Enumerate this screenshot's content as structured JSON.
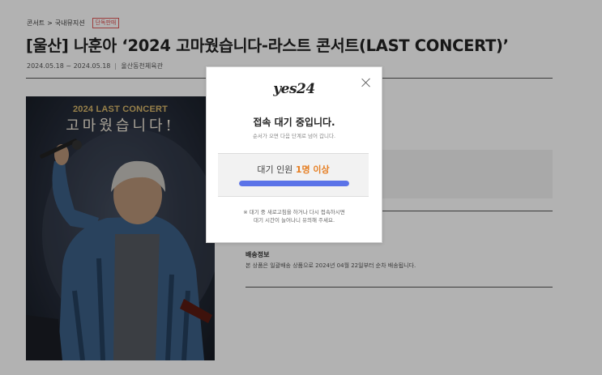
{
  "breadcrumb": {
    "category": "콘서트",
    "separator": ">",
    "subcategory": "국내뮤지션",
    "badge": "단독판매"
  },
  "event": {
    "title": "[울산] 나훈아 ‘2024 고마웠습니다-라스트 콘서트(LAST CONCERT)’",
    "dates": "2024.05.18 ~ 2024.05.18",
    "venue": "울산동천체육관"
  },
  "poster": {
    "title_en": "2024 LAST CONCERT",
    "title_ko": "고마웠습니다!"
  },
  "shipping": {
    "label": "배송정보",
    "text": "본 상품은 일괄배송 상품으로 2024년 04월 22일부터 순차 배송됩니다."
  },
  "modal": {
    "logo": "yes24",
    "title": "접속 대기 중입니다.",
    "subtitle": "순서가 오면 다음 단계로 넘어 갑니다.",
    "queue_label": "대기 인원",
    "queue_count": "1명 이상",
    "progress": 1.0,
    "notice_line1": "※ 대기 중 새로고침을 하거나 다시 접속하시면",
    "notice_line2": "대기 시간이 늘어나니 유의해 주세요."
  },
  "colors": {
    "accent": "#e67e22",
    "progress": "#5b73e8",
    "badge": "#e05a5a"
  }
}
